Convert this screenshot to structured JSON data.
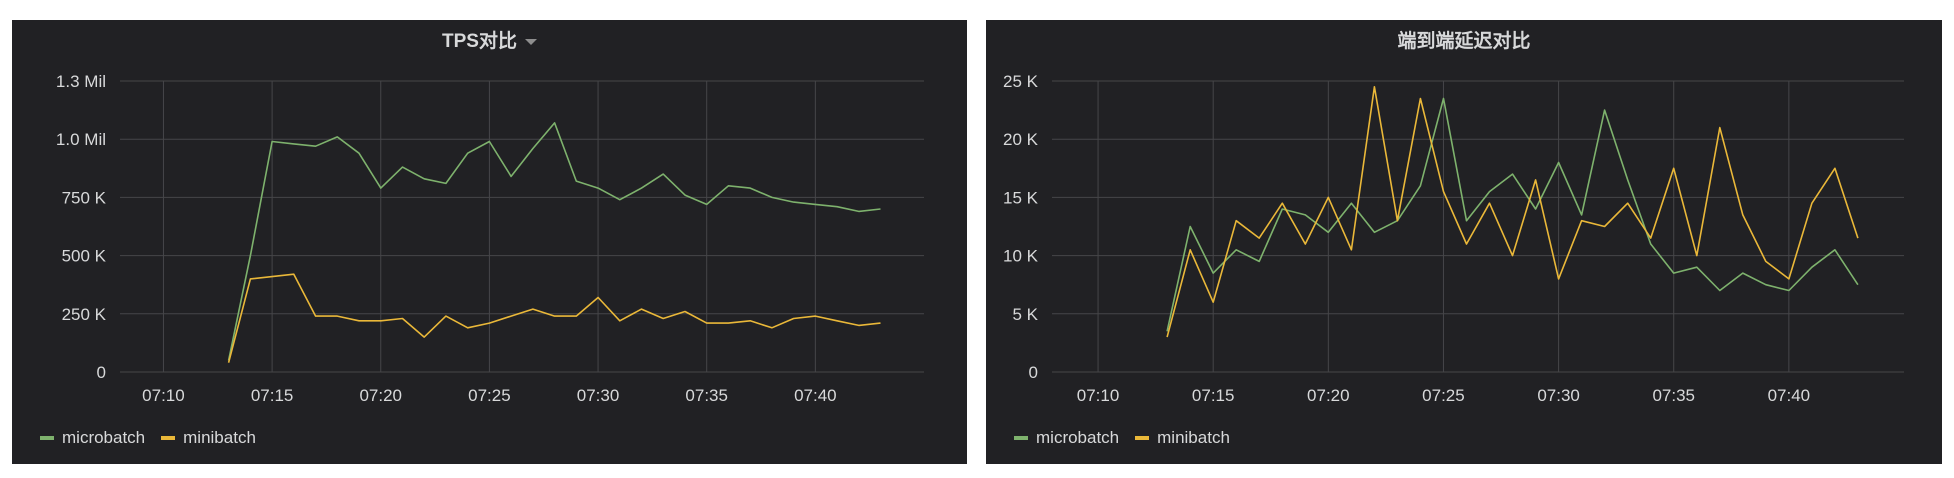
{
  "panels": [
    {
      "title": "TPS对比",
      "legend": [
        {
          "name": "microbatch",
          "color": "#7eb26d"
        },
        {
          "name": "minibatch",
          "color": "#eab839"
        }
      ]
    },
    {
      "title": "端到端延迟对比",
      "legend": [
        {
          "name": "microbatch",
          "color": "#7eb26d"
        },
        {
          "name": "minibatch",
          "color": "#eab839"
        }
      ]
    }
  ],
  "chart_data": [
    {
      "type": "line",
      "title": "TPS对比",
      "grid": true,
      "legend_position": "bottom-left",
      "x_ticks": [
        "07:10",
        "07:15",
        "07:20",
        "07:25",
        "07:30",
        "07:35",
        "07:40"
      ],
      "x_range": [
        "07:08:00",
        "07:45:00"
      ],
      "y_ticks": [
        {
          "value": 0,
          "label": "0"
        },
        {
          "value": 250000,
          "label": "250 K"
        },
        {
          "value": 500000,
          "label": "500 K"
        },
        {
          "value": 750000,
          "label": "750 K"
        },
        {
          "value": 1000000,
          "label": "1.0 Mil"
        },
        {
          "value": 1250000,
          "label": "1.3 Mil"
        }
      ],
      "ylim": [
        0,
        1250000
      ],
      "x": [
        "07:13",
        "07:14",
        "07:15",
        "07:16",
        "07:17",
        "07:18",
        "07:19",
        "07:20",
        "07:21",
        "07:22",
        "07:23",
        "07:24",
        "07:25",
        "07:26",
        "07:27",
        "07:28",
        "07:29",
        "07:30",
        "07:31",
        "07:32",
        "07:33",
        "07:34",
        "07:35",
        "07:36",
        "07:37",
        "07:38",
        "07:39",
        "07:40",
        "07:41",
        "07:42",
        "07:43"
      ],
      "series": [
        {
          "name": "microbatch",
          "color": "#7eb26d",
          "values": [
            50000,
            500000,
            990000,
            980000,
            970000,
            1010000,
            940000,
            790000,
            880000,
            830000,
            810000,
            940000,
            990000,
            840000,
            960000,
            1070000,
            820000,
            790000,
            740000,
            790000,
            850000,
            760000,
            720000,
            800000,
            790000,
            750000,
            730000,
            720000,
            710000,
            690000,
            700000
          ]
        },
        {
          "name": "minibatch",
          "color": "#eab839",
          "values": [
            40000,
            400000,
            410000,
            420000,
            240000,
            240000,
            220000,
            220000,
            230000,
            150000,
            240000,
            190000,
            210000,
            240000,
            270000,
            240000,
            240000,
            320000,
            220000,
            270000,
            230000,
            260000,
            210000,
            210000,
            220000,
            190000,
            230000,
            240000,
            220000,
            200000,
            210000
          ]
        }
      ]
    },
    {
      "type": "line",
      "title": "端到端延迟对比",
      "grid": true,
      "legend_position": "bottom-left",
      "x_ticks": [
        "07:10",
        "07:15",
        "07:20",
        "07:25",
        "07:30",
        "07:35",
        "07:40"
      ],
      "x_range": [
        "07:08:00",
        "07:45:00"
      ],
      "y_ticks": [
        {
          "value": 0,
          "label": "0"
        },
        {
          "value": 5000,
          "label": "5 K"
        },
        {
          "value": 10000,
          "label": "10 K"
        },
        {
          "value": 15000,
          "label": "15 K"
        },
        {
          "value": 20000,
          "label": "20 K"
        },
        {
          "value": 25000,
          "label": "25 K"
        }
      ],
      "ylim": [
        0,
        25000
      ],
      "x": [
        "07:13",
        "07:14",
        "07:15",
        "07:16",
        "07:17",
        "07:18",
        "07:19",
        "07:20",
        "07:21",
        "07:22",
        "07:23",
        "07:24",
        "07:25",
        "07:26",
        "07:27",
        "07:28",
        "07:29",
        "07:30",
        "07:31",
        "07:32",
        "07:33",
        "07:34",
        "07:35",
        "07:36",
        "07:37",
        "07:38",
        "07:39",
        "07:40",
        "07:41",
        "07:42",
        "07:43"
      ],
      "series": [
        {
          "name": "microbatch",
          "color": "#7eb26d",
          "values": [
            3500,
            12500,
            8500,
            10500,
            9500,
            14000,
            13500,
            12000,
            14500,
            12000,
            13000,
            16000,
            23500,
            13000,
            15500,
            17000,
            14000,
            18000,
            13500,
            22500,
            16500,
            11000,
            8500,
            9000,
            7000,
            8500,
            7500,
            7000,
            9000,
            10500,
            7500
          ]
        },
        {
          "name": "minibatch",
          "color": "#eab839",
          "values": [
            3000,
            10500,
            6000,
            13000,
            11500,
            14500,
            11000,
            15000,
            10500,
            24500,
            13000,
            23500,
            15500,
            11000,
            14500,
            10000,
            16500,
            8000,
            13000,
            12500,
            14500,
            11500,
            17500,
            10000,
            21000,
            13500,
            9500,
            8000,
            14500,
            17500,
            11500
          ]
        }
      ]
    }
  ]
}
